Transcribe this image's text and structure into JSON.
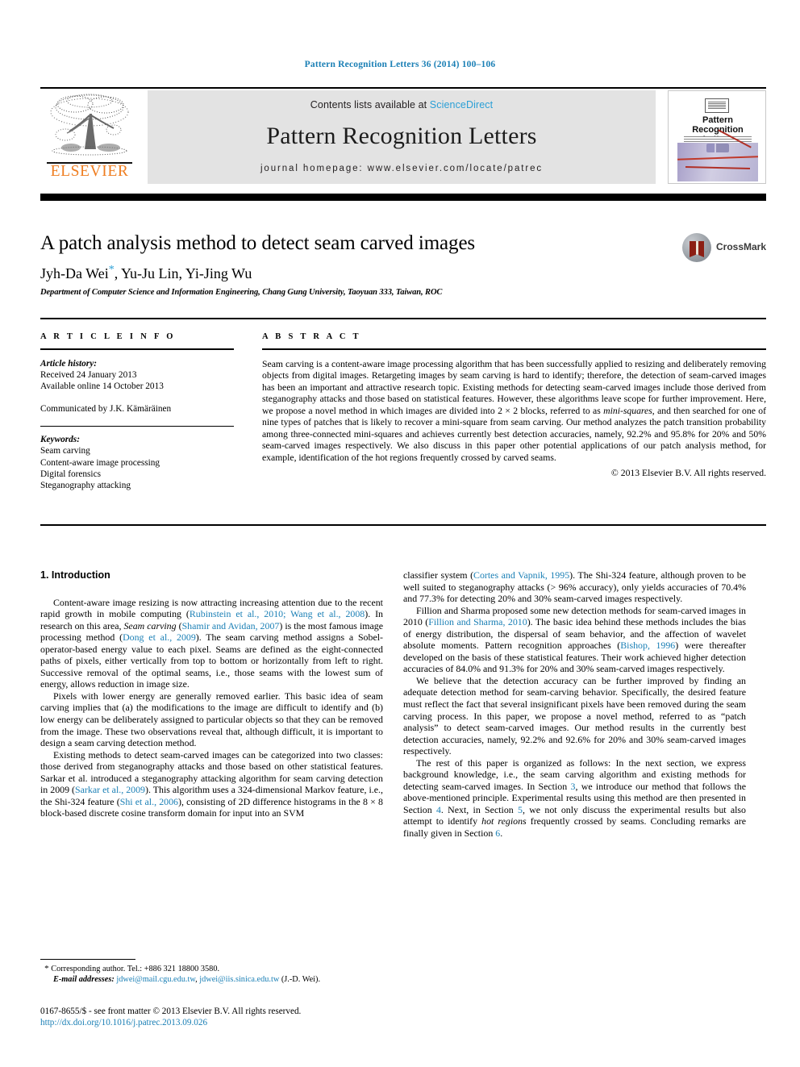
{
  "running_head": "Pattern Recognition Letters 36 (2014) 100–106",
  "masthead": {
    "publisher_wordmark": "ELSEVIER",
    "contents_prefix": "Contents lists available at ",
    "contents_link": "ScienceDirect",
    "journal_title": "Pattern Recognition Letters",
    "homepage": "journal homepage: www.elsevier.com/locate/patrec",
    "cover_title_line1": "Pattern Recognition",
    "cover_title_line2": "Letters"
  },
  "article": {
    "title": "A patch analysis method to detect seam carved images",
    "authors_pre": "Jyh-Da Wei",
    "authors_star": "*",
    "authors_post": ", Yu-Ju Lin, Yi-Jing Wu",
    "affiliation": "Department of Computer Science and Information Engineering, Chang Gung University, Taoyuan 333, Taiwan, ROC",
    "crossmark_label": "CrossMark"
  },
  "article_info": {
    "heading": "A R T I C L E   I N F O",
    "history_label": "Article history:",
    "received": "Received 24 January 2013",
    "available": "Available online 14 October 2013",
    "communicated": "Communicated by J.K. Kämäräinen",
    "keywords_label": "Keywords:",
    "keywords": [
      "Seam carving",
      "Content-aware image processing",
      "Digital forensics",
      "Steganography attacking"
    ]
  },
  "abstract": {
    "heading": "A B S T R A C T",
    "text_part1": "Seam carving is a content-aware image processing algorithm that has been successfully applied to resizing and deliberately removing objects from digital images. Retargeting images by seam carving is hard to identify; therefore, the detection of seam-carved images has been an important and attractive research topic. Existing methods for detecting seam-carved images include those derived from steganography attacks and those based on statistical features. However, these algorithms leave scope for further improvement. Here, we propose a novel method in which images are divided into 2 × 2 blocks, referred to as ",
    "italic1": "mini-squares",
    "text_part2": ", and then searched for one of nine types of patches that is likely to recover a mini-square from seam carving. Our method analyzes the patch transition probability among three-connected mini-squares and achieves currently best detection accuracies, namely, 92.2% and 95.8% for 20% and 50% seam-carved images respectively. We also discuss in this paper other potential applications of our patch analysis method, for example, identification of the hot regions frequently crossed by carved seams.",
    "copyright": "© 2013 Elsevier B.V. All rights reserved."
  },
  "section1": {
    "heading": "1. Introduction",
    "p1_a": "Content-aware image resizing is now attracting increasing attention due to the recent rapid growth in mobile computing (",
    "p1_ref1": "Rubinstein et al., 2010; Wang et al., 2008",
    "p1_b": "). In research on this area, ",
    "p1_it1": "Seam carving",
    "p1_c": " (",
    "p1_ref2": "Shamir and Avidan, 2007",
    "p1_d": ") is the most famous image processing method (",
    "p1_ref3": "Dong et al., 2009",
    "p1_e": "). The seam carving method assigns a Sobel-operator-based energy value to each pixel. Seams are defined as the eight-connected paths of pixels, either vertically from top to bottom or horizontally from left to right. Successive removal of the optimal seams, i.e., those seams with the lowest sum of energy, allows reduction in image size.",
    "p2": "Pixels with lower energy are generally removed earlier. This basic idea of seam carving implies that (a) the modifications to the image are difficult to identify and (b) low energy can be deliberately assigned to particular objects so that they can be removed from the image. These two observations reveal that, although difficult, it is important to design a seam carving detection method.",
    "p3_a": "Existing methods to detect seam-carved images can be categorized into two classes: those derived from steganography attacks and those based on other statistical features. Sarkar et al. introduced a steganography attacking algorithm for seam carving detection in 2009 (",
    "p3_ref1": "Sarkar et al., 2009",
    "p3_b": "). This algorithm uses a 324-dimensional Markov feature, i.e., the Shi-324 feature (",
    "p3_ref2": "Shi et al., 2006",
    "p3_c": "), consisting of 2D difference histograms in the 8 × 8 block-based discrete cosine transform domain for input into an SVM",
    "p4_a": "classifier system (",
    "p4_ref1": "Cortes and Vapnik, 1995",
    "p4_b": "). The Shi-324 feature, although proven to be well suited to steganography attacks (> 96% accuracy), only yields accuracies of 70.4% and 77.3% for detecting 20% and 30% seam-carved images respectively.",
    "p5_a": "Fillion and Sharma proposed some new detection methods for seam-carved images in 2010 (",
    "p5_ref1": "Fillion and Sharma, 2010",
    "p5_b": "). The basic idea behind these methods includes the bias of energy distribution, the dispersal of seam behavior, and the affection of wavelet absolute moments. Pattern recognition approaches (",
    "p5_ref2": "Bishop, 1996",
    "p5_c": ") were thereafter developed on the basis of these statistical features. Their work achieved higher detection accuracies of 84.0% and 91.3% for 20% and 30% seam-carved images respectively.",
    "p6": "We believe that the detection accuracy can be further improved by finding an adequate detection method for seam-carving behavior. Specifically, the desired feature must reflect the fact that several insignificant pixels have been removed during the seam carving process. In this paper, we propose a novel method, referred to as “patch analysis” to detect seam-carved images. Our method results in the currently best detection accuracies, namely, 92.2% and 92.6% for 20% and 30% seam-carved images respectively.",
    "p7_a": "The rest of this paper is organized as follows: In the next section, we express background knowledge, i.e., the seam carving algorithm and existing methods for detecting seam-carved images. In Section ",
    "p7_s3": "3",
    "p7_b": ", we introduce our method that follows the above-mentioned principle. Experimental results using this method are then presented in Section ",
    "p7_s4": "4",
    "p7_c": ". Next, in Section ",
    "p7_s5": "5",
    "p7_d": ", we not only discuss the experimental results but also attempt to identify ",
    "p7_it": "hot regions",
    "p7_e": " frequently crossed by seams. Concluding remarks are finally given in Section ",
    "p7_s6": "6",
    "p7_f": "."
  },
  "footnote": {
    "star": "*",
    "corresponding": " Corresponding author. Tel.: +886 321 18800 3580.",
    "email_label": "E-mail addresses:",
    "email1": "jdwei@mail.cgu.edu.tw",
    "email_sep": ", ",
    "email2": "jdwei@iis.sinica.edu.tw",
    "email_suffix": " (J.-D. Wei)."
  },
  "imprint": {
    "line1": "0167-8655/$ - see front matter © 2013 Elsevier B.V. All rights reserved.",
    "doi": "http://dx.doi.org/10.1016/j.patrec.2013.09.026"
  },
  "colors": {
    "link": "#1a7fb5",
    "sciencedirect": "#2a9fd6",
    "elsevier_orange": "#ef7e21",
    "banner_gray": "#e3e3e3"
  }
}
